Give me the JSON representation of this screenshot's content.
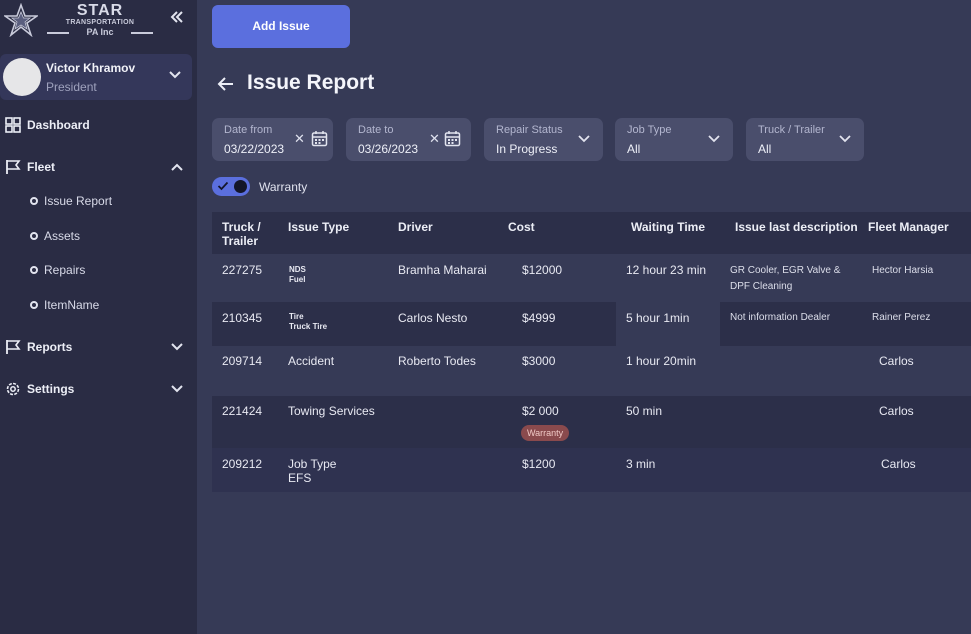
{
  "brand": {
    "line1": "STAR",
    "line2": "TRANSPORTATION",
    "line3": "PA Inc"
  },
  "profile": {
    "name": "Victor Khramov",
    "role": "President"
  },
  "nav": {
    "dashboard": "Dashboard",
    "fleet": "Fleet",
    "fleet_items": [
      "Issue Report",
      "Assets",
      "Repairs",
      "ItemName"
    ],
    "reports": "Reports",
    "settings": "Settings"
  },
  "actions": {
    "add_issue": "Add Issue"
  },
  "page": {
    "title": "Issue Report"
  },
  "filters": {
    "date_from": {
      "label": "Date from",
      "value": "03/22/2023"
    },
    "date_to": {
      "label": "Date to",
      "value": "03/26/2023"
    },
    "repair_status": {
      "label": "Repair Status",
      "value": "In Progress"
    },
    "job_type": {
      "label": "Job Type",
      "value": "All"
    },
    "truck_trailer": {
      "label": "Truck / Trailer",
      "value": "All"
    },
    "clear_symbol": "✕"
  },
  "warranty_toggle": {
    "label": "Warranty",
    "on": true
  },
  "table": {
    "headers": {
      "truck": "Truck /\nTrailer",
      "issue_type": "Issue Type",
      "driver": "Driver",
      "cost": "Cost",
      "waiting": "Waiting Time",
      "description": "Issue last description",
      "manager": "Fleet Manager"
    },
    "rows": [
      {
        "truck": "227275",
        "issue_main": "NDS",
        "issue_sub": "Fuel",
        "driver": "Bramha Maharai",
        "cost": "$12000",
        "waiting": "12 hour 23 min",
        "description": "GR Cooler, EGR Valve &\nDPF Cleaning",
        "manager": "Hector Harsia"
      },
      {
        "truck": "210345",
        "issue_main": "Tire",
        "issue_sub": "Truck Tire",
        "driver": "Carlos Nesto",
        "cost": "$4999",
        "waiting": "5 hour 1min",
        "description": "Not information Dealer",
        "manager": "Rainer Perez"
      },
      {
        "truck": "209714",
        "issue": "Accident",
        "driver": "Roberto Todes",
        "cost": "$3000",
        "waiting": "1 hour 20min",
        "description": "",
        "manager": "Carlos"
      },
      {
        "truck": "221424",
        "issue": "Towing Services",
        "driver": "",
        "cost": "$2 000",
        "badge": "Warranty",
        "waiting": "50 min",
        "description": "",
        "manager": "Carlos"
      },
      {
        "truck": "209212",
        "issue": "Job Type\nEFS",
        "driver": "",
        "cost": "$1200",
        "waiting": "3 min",
        "description": "",
        "manager": "Carlos"
      }
    ]
  },
  "colors": {
    "accent": "#5b6fde",
    "sidebar_bg": "#2a2c44",
    "main_bg": "#363a56",
    "badge_bg": "#8a4a4d"
  },
  "icons": {
    "logo": "star-logo-icon",
    "collapse": "double-chevron-left-icon",
    "dashboard": "grid-icon",
    "fleet": "flag-icon",
    "reports": "flag-icon",
    "settings": "gear-icon",
    "calendar": "calendar-icon",
    "back": "arrow-left-icon"
  }
}
